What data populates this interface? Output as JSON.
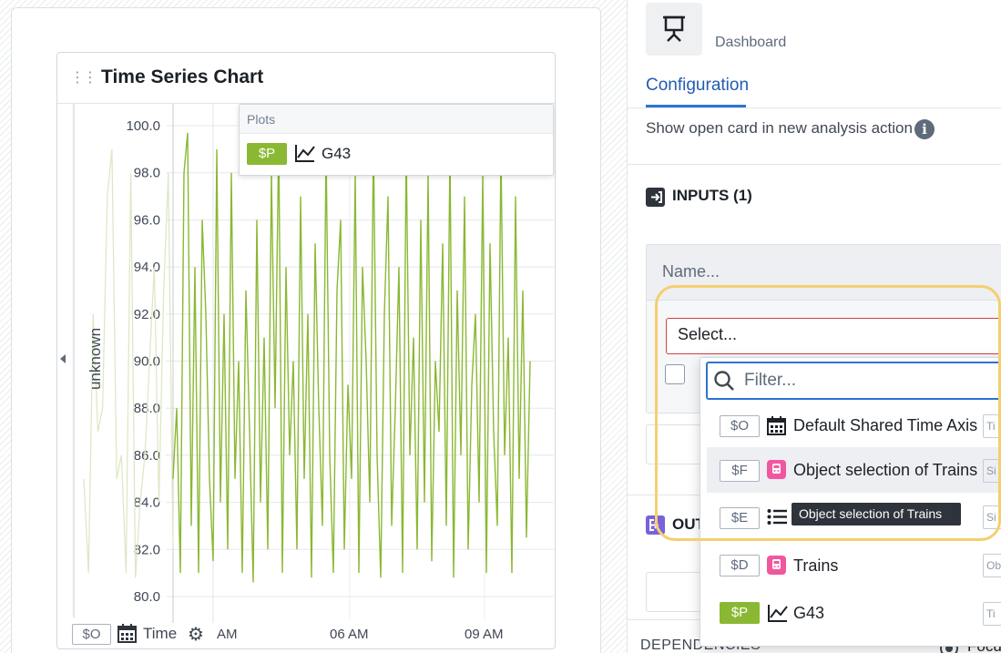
{
  "widget": {
    "title": "Time Series Chart",
    "plots_header": "Plots",
    "plot_item": {
      "badge": "$P",
      "label": "G43"
    },
    "footer": {
      "badge": "$O",
      "time_label": "Time"
    }
  },
  "chart_data": {
    "type": "line",
    "ylabel": "unknown",
    "ylim": [
      80,
      100
    ],
    "y_ticks": [
      "100.0",
      "98.0",
      "96.0",
      "94.0",
      "92.0",
      "90.0",
      "88.0",
      "86.0",
      "84.0",
      "82.0",
      "80.0"
    ],
    "x_ticks": [
      "AM",
      "06 AM",
      "09 AM"
    ],
    "series": [
      {
        "color": "#8ab833",
        "values": [
          85,
          88,
          81,
          98,
          99.7,
          83,
          94,
          81,
          96,
          92,
          85,
          81.5,
          99,
          84,
          92,
          82,
          98,
          85,
          90,
          81,
          93,
          87,
          80.6,
          96,
          84,
          91,
          82,
          98,
          88,
          99.5,
          81,
          94,
          86,
          90,
          82,
          97,
          85,
          92,
          80.8,
          95,
          88,
          83,
          99,
          86,
          81,
          93,
          96,
          82,
          89,
          85,
          98,
          81,
          94,
          90,
          84,
          99.3,
          86,
          80.8,
          92,
          97,
          83,
          88,
          94,
          81,
          99,
          86,
          91,
          82,
          96,
          84,
          98,
          81.5,
          90,
          87,
          95,
          83,
          99,
          80.8,
          93,
          86,
          97,
          82,
          89,
          92,
          84,
          98,
          81,
          95,
          87,
          83,
          99,
          86,
          91,
          81,
          97,
          85,
          93,
          82.5,
          90
        ]
      }
    ],
    "faded_series_color": "#dde8c6"
  },
  "panel": {
    "app_label": "Dashboard",
    "tab": "Configuration",
    "show_open_action": "Show open card in new analysis action",
    "info_icon": "i",
    "inputs_label": "INPUTS (1)",
    "name_placeholder": "Name...",
    "select_placeholder": "Select...",
    "outputs_label": "OUT",
    "dependencies_label": "DEPENDENCIES",
    "focus_label": "Focu"
  },
  "dropdown": {
    "filter_placeholder": "Filter...",
    "items": [
      {
        "badge": "$O",
        "icon": "calendar-icon",
        "label": "Default Shared Time Axis",
        "chip": "Ti"
      },
      {
        "badge": "$F",
        "icon": "train-icon",
        "label": "Object selection of Trains",
        "chip": "Si"
      },
      {
        "badge": "$E",
        "icon": "list-icon",
        "label": "",
        "chip": "Si"
      },
      {
        "badge": "$D",
        "icon": "train-icon",
        "label": "Trains",
        "chip": "Ob"
      },
      {
        "badge": "$P",
        "icon": "line-chart-icon",
        "label": "G43",
        "chip": "Ti"
      }
    ],
    "tooltip": "Object selection of Trains"
  }
}
